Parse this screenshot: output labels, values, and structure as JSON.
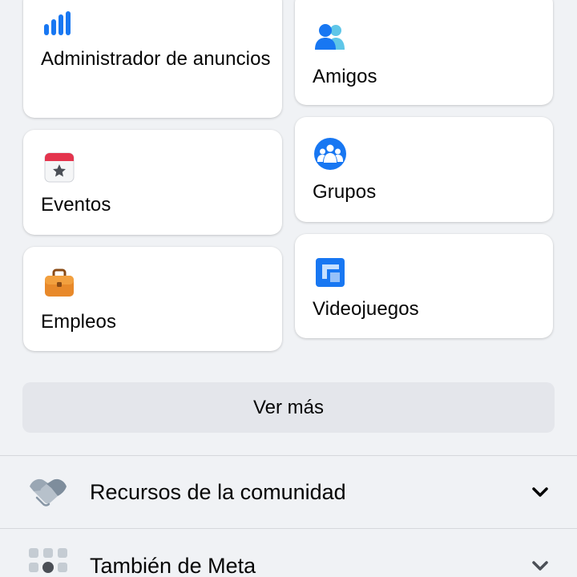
{
  "shortcuts": [
    {
      "label": "Administrador de anuncios",
      "icon": "bar-chart-icon"
    },
    {
      "label": "Amigos",
      "icon": "friends-icon"
    },
    {
      "label": "Eventos",
      "icon": "calendar-star-icon"
    },
    {
      "label": "Grupos",
      "icon": "groups-icon"
    },
    {
      "label": "Empleos",
      "icon": "briefcase-icon"
    },
    {
      "label": "Videojuegos",
      "icon": "gaming-icon"
    }
  ],
  "see_more_label": "Ver más",
  "sections": [
    {
      "label": "Recursos de la comunidad",
      "icon": "handshake-icon",
      "expanded": false
    },
    {
      "label": "También de Meta",
      "icon": "grid-dots-icon",
      "expanded": false
    }
  ],
  "colors": {
    "background": "#f0f2f5",
    "card": "#ffffff",
    "accent_blue": "#1877f2",
    "button_gray": "#e4e6eb",
    "text": "#050505"
  }
}
